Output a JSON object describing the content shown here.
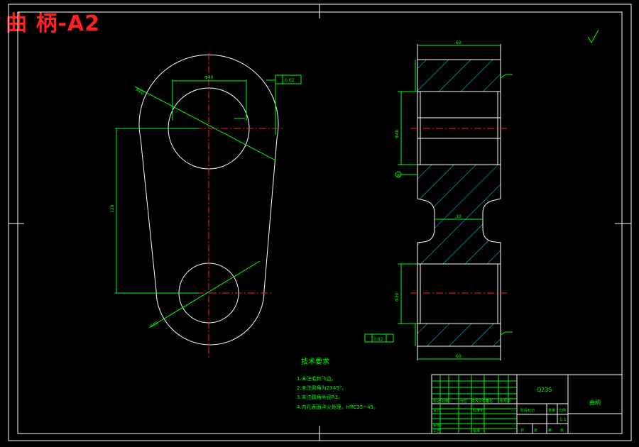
{
  "drawing_title": "曲 柄-A2",
  "tech_requirements": {
    "heading": "技术要求",
    "items": [
      "1.未注毛刺飞边。",
      "2.未注倒角为2X45°。",
      "3.未注圆角半径R3。",
      "4.内孔表面淬火处理，HRC35~45。"
    ]
  },
  "front_view": {
    "top_hole_dim": "Φ40",
    "center_distance_dim": "120",
    "top_radius_leader": "R60",
    "bottom_radius_leader": "R40",
    "tolerance_frame": "0.02"
  },
  "side_view": {
    "overall_width_top": "60",
    "overall_width_bottom": "60",
    "neck_width": "30",
    "top_bore_dim": "Φ40",
    "bottom_bore_dim": "Φ30",
    "datum_label": "A",
    "tolerance_frame": "0.02"
  },
  "title_block": {
    "material": "Q235",
    "part_name": "曲柄",
    "scale": "1:1",
    "labels": [
      "标记",
      "处数",
      "分区",
      "更改文件号",
      "签名",
      "年月日",
      "设计",
      "标准化",
      "阶段标记",
      "重量",
      "比例",
      "审核",
      "工艺",
      "批准",
      "共",
      "张",
      "第",
      "张"
    ]
  },
  "colors": {
    "outline": "#ffffff",
    "centerline": "#ff2020",
    "dimension": "#00ff00",
    "hatch": "#00e5ff",
    "title": "#ff2020",
    "note": "#00ff00"
  }
}
